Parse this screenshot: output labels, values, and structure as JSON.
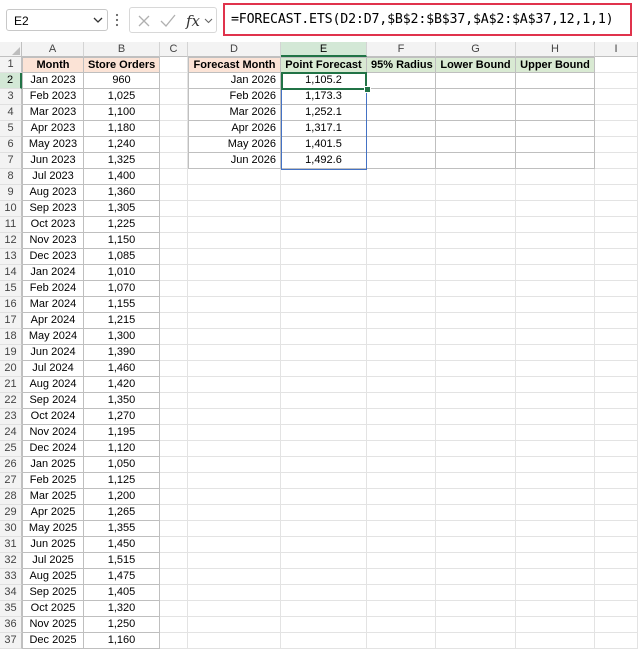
{
  "name_box": "E2",
  "formula": "=FORECAST.ETS(D2:D7,$B$2:$B$37,$A$2:$A$37,12,1,1)",
  "icons": {
    "namebox_dropdown": "chevron-down-icon",
    "more": "vertical-dots-icon",
    "cancel": "close-icon",
    "enter": "check-icon",
    "function": "fx-icon"
  },
  "columns": [
    "A",
    "B",
    "C",
    "D",
    "E",
    "F",
    "G",
    "H",
    "I"
  ],
  "row_numbers": [
    "1",
    "2",
    "3",
    "4",
    "5",
    "6",
    "7",
    "8",
    "9",
    "10",
    "11",
    "12",
    "13",
    "14",
    "15",
    "16",
    "17",
    "18",
    "19",
    "20",
    "21",
    "22",
    "23",
    "24",
    "25",
    "26",
    "27",
    "28",
    "29",
    "30",
    "31",
    "32",
    "33",
    "34",
    "35",
    "36",
    "37"
  ],
  "history_headers": {
    "month": "Month",
    "orders": "Store Orders"
  },
  "history": [
    [
      "Jan 2023",
      "960"
    ],
    [
      "Feb 2023",
      "1,025"
    ],
    [
      "Mar 2023",
      "1,100"
    ],
    [
      "Apr 2023",
      "1,180"
    ],
    [
      "May 2023",
      "1,240"
    ],
    [
      "Jun 2023",
      "1,325"
    ],
    [
      "Jul 2023",
      "1,400"
    ],
    [
      "Aug 2023",
      "1,360"
    ],
    [
      "Sep 2023",
      "1,305"
    ],
    [
      "Oct 2023",
      "1,225"
    ],
    [
      "Nov 2023",
      "1,150"
    ],
    [
      "Dec 2023",
      "1,085"
    ],
    [
      "Jan 2024",
      "1,010"
    ],
    [
      "Feb 2024",
      "1,070"
    ],
    [
      "Mar 2024",
      "1,155"
    ],
    [
      "Apr 2024",
      "1,215"
    ],
    [
      "May 2024",
      "1,300"
    ],
    [
      "Jun 2024",
      "1,390"
    ],
    [
      "Jul 2024",
      "1,460"
    ],
    [
      "Aug 2024",
      "1,420"
    ],
    [
      "Sep 2024",
      "1,350"
    ],
    [
      "Oct 2024",
      "1,270"
    ],
    [
      "Nov 2024",
      "1,195"
    ],
    [
      "Dec 2024",
      "1,120"
    ],
    [
      "Jan 2025",
      "1,050"
    ],
    [
      "Feb 2025",
      "1,125"
    ],
    [
      "Mar 2025",
      "1,200"
    ],
    [
      "Apr 2025",
      "1,265"
    ],
    [
      "May 2025",
      "1,355"
    ],
    [
      "Jun 2025",
      "1,450"
    ],
    [
      "Jul 2025",
      "1,515"
    ],
    [
      "Aug 2025",
      "1,475"
    ],
    [
      "Sep 2025",
      "1,405"
    ],
    [
      "Oct 2025",
      "1,320"
    ],
    [
      "Nov 2025",
      "1,250"
    ],
    [
      "Dec 2025",
      "1,160"
    ]
  ],
  "forecast_headers": {
    "month": "Forecast Month",
    "point": "Point Forecast",
    "radius": "95% Radius",
    "lower": "Lower Bound",
    "upper": "Upper Bound"
  },
  "forecast": [
    [
      "Jan 2026",
      "1,105.2"
    ],
    [
      "Feb 2026",
      "1,173.3"
    ],
    [
      "Mar 2026",
      "1,252.1"
    ],
    [
      "Apr 2026",
      "1,317.1"
    ],
    [
      "May 2026",
      "1,401.5"
    ],
    [
      "Jun 2026",
      "1,492.6"
    ]
  ],
  "colors": {
    "selection": "#217346",
    "formula_highlight": "#e0334c",
    "peach_header": "#fbe3d6",
    "green_header": "#d9ead3",
    "range_blue": "#4472c4"
  }
}
